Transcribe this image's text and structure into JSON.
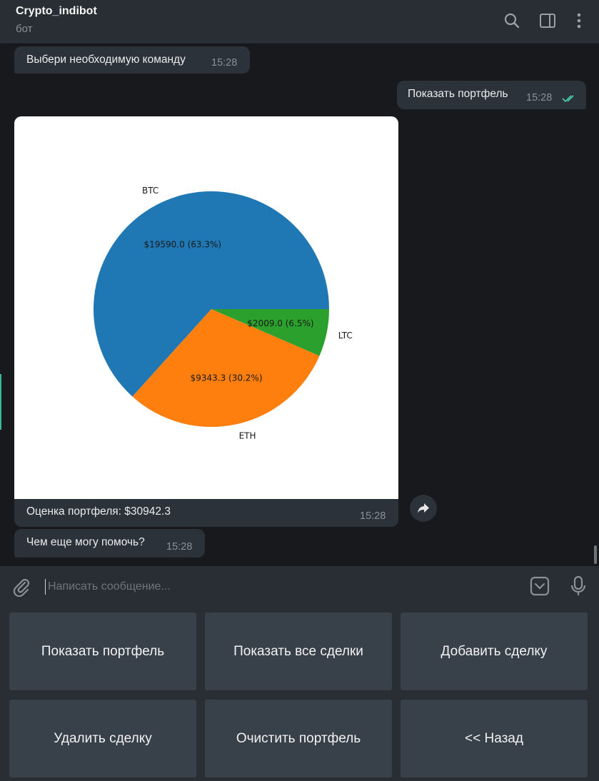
{
  "header": {
    "title": "Crypto_indibot",
    "subtitle": "бот"
  },
  "messages": [
    {
      "text": "Выбери необходимую команду",
      "time": "15:28",
      "direction": "incoming"
    },
    {
      "text": "Показать портфель",
      "time": "15:28",
      "direction": "outgoing",
      "status": "read"
    },
    {
      "text": "Оценка портфеля: $30942.3",
      "time": "15:28",
      "direction": "incoming",
      "has_image": true
    },
    {
      "text": "Чем еще могу помочь?",
      "time": "15:28",
      "direction": "incoming"
    }
  ],
  "chart_data": {
    "type": "pie",
    "labels": [
      "BTC",
      "ETH",
      "LTC"
    ],
    "values": [
      19590.0,
      9343.3,
      2009.0
    ],
    "percent": [
      63.3,
      30.2,
      6.5
    ],
    "slice_labels": [
      "$19590.0 (63.3%)",
      "$9343.3 (30.2%)",
      "$2009.0 (6.5%)"
    ],
    "colors": [
      "#1f77b4",
      "#ff7f0e",
      "#2ca02c"
    ]
  },
  "composer": {
    "placeholder": "Написать сообщение..."
  },
  "keyboard": {
    "buttons": [
      "Показать портфель",
      "Показать все сделки",
      "Добавить сделку",
      "Удалить сделку",
      "Очистить портфель",
      "<< Назад"
    ]
  },
  "icons": {
    "search": "search-icon",
    "sidebar": "sidebar-toggle-icon",
    "menu": "more-vertical-icon",
    "share": "share-icon",
    "attach": "paperclip-icon",
    "emoji": "emoji-icon",
    "mic": "microphone-icon"
  },
  "colors": {
    "background": "#18191d",
    "panel": "#282e33",
    "bubble": "#2b323a",
    "read_check": "#4dcdb0",
    "keyboard_button": "#384049"
  }
}
